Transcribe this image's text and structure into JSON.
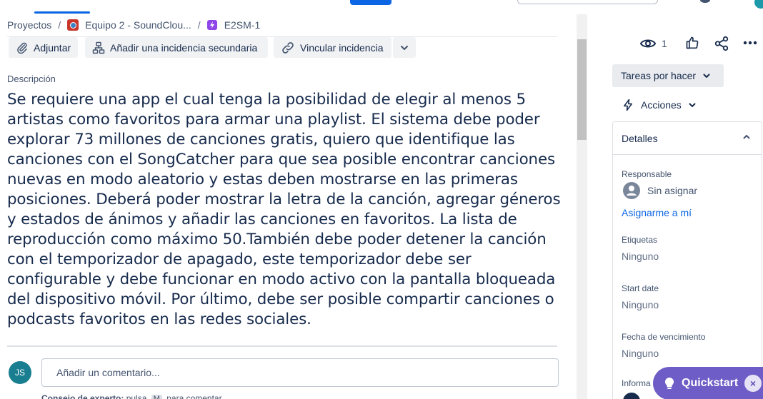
{
  "breadcrumb": {
    "items": [
      "Proyectos",
      "Equipo 2 - SoundClou...",
      "E2SM-1"
    ],
    "separator": "/"
  },
  "actions": {
    "attach": "Adjuntar",
    "add_child": "Añadir una incidencia secundaria",
    "link_issue": "Vincular incidencia"
  },
  "description": {
    "label": "Descripción",
    "text": "Se requiere una app el cual tenga la posibilidad de elegir al menos 5 artistas como favoritos para armar una playlist. El sistema debe poder explorar 73 millones de canciones gratis, quiero que identifique las canciones con el SongCatcher para que sea posible encontrar canciones nuevas en modo aleatorio y estas deben mostrarse en las primeras posiciones. Deberá poder mostrar la letra de la canción, agregar géneros y estados de ánimos y añadir las canciones en favoritos. La lista de reproducción como máximo 50.También debe poder detener la canción con el temporizador de apagado, este temporizador debe ser configurable y debe funcionar en modo activo con la pantalla bloqueada del dispositivo móvil. Por último, debe ser posible compartir canciones o podcasts favoritos en las redes sociales."
  },
  "comment": {
    "avatar_initials": "JS",
    "placeholder": "Añadir un comentario...",
    "tip_bold": "Consejo de experto:",
    "tip_text": " pulsa ",
    "tip_key": "M",
    "tip_suffix": " para comentar"
  },
  "right": {
    "watchers_count": "1",
    "status": "Tareas por hacer",
    "actions_label": "Acciones",
    "details": {
      "title": "Detalles",
      "assignee_label": "Responsable",
      "assignee_value": "Sin asignar",
      "assign_me": "Asignarme a mí",
      "labels_label": "Etiquetas",
      "labels_value": "Ninguno",
      "start_label": "Start date",
      "start_value": "Ninguno",
      "due_label": "Fecha de vencimiento",
      "due_value": "Ninguno",
      "info_label": "Informa"
    }
  },
  "quickstart": {
    "label": "Quickstart",
    "close": "×"
  },
  "colors": {
    "accent": "#0c66e4",
    "quickstart": "#6e5dc6",
    "avatar": "#1a7e91",
    "epic_icon": "#8f46e8",
    "project_icon": "#c9372c"
  }
}
